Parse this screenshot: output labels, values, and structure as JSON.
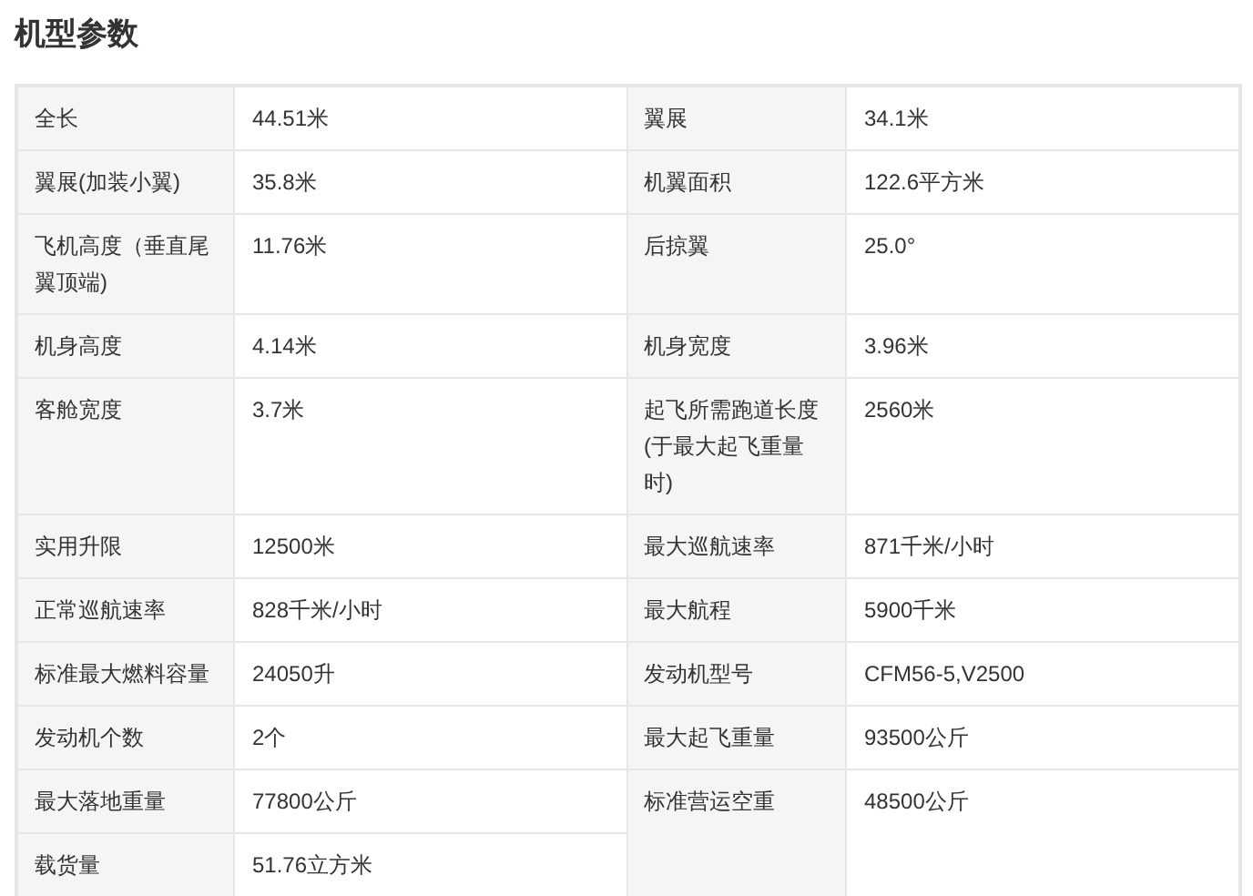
{
  "title": "机型参数",
  "rows": [
    {
      "left": {
        "label": "全长",
        "value": "44.51米"
      },
      "right": {
        "label": "翼展",
        "value": "34.1米"
      }
    },
    {
      "left": {
        "label": "翼展(加装小翼)",
        "value": "35.8米"
      },
      "right": {
        "label": "机翼面积",
        "value": "122.6平方米"
      }
    },
    {
      "left": {
        "label": "飞机高度（垂直尾翼顶端)",
        "value": "11.76米"
      },
      "right": {
        "label": "后掠翼",
        "value": "25.0°"
      }
    },
    {
      "left": {
        "label": "机身高度",
        "value": "4.14米"
      },
      "right": {
        "label": "机身宽度",
        "value": "3.96米"
      }
    },
    {
      "left": {
        "label": "客舱宽度",
        "value": "3.7米"
      },
      "right": {
        "label": "起飞所需跑道长度(于最大起飞重量时)",
        "value": "2560米"
      }
    },
    {
      "left": {
        "label": "实用升限",
        "value": "12500米"
      },
      "right": {
        "label": "最大巡航速率",
        "value": "871千米/小时"
      }
    },
    {
      "left": {
        "label": "正常巡航速率",
        "value": "828千米/小时"
      },
      "right": {
        "label": "最大航程",
        "value": "5900千米"
      }
    },
    {
      "left": {
        "label": "标准最大燃料容量",
        "value": "24050升"
      },
      "right": {
        "label": "发动机型号",
        "value": "CFM56-5,V2500"
      }
    },
    {
      "left": {
        "label": "发动机个数",
        "value": "2个"
      },
      "right": {
        "label": "最大起飞重量",
        "value": "93500公斤"
      }
    },
    {
      "left": {
        "label": "最大落地重量",
        "value": "77800公斤"
      },
      "right": {
        "label": "标准营运空重",
        "value": "48500公斤"
      }
    },
    {
      "left": {
        "label": "载货量",
        "value": "51.76立方米"
      }
    }
  ]
}
